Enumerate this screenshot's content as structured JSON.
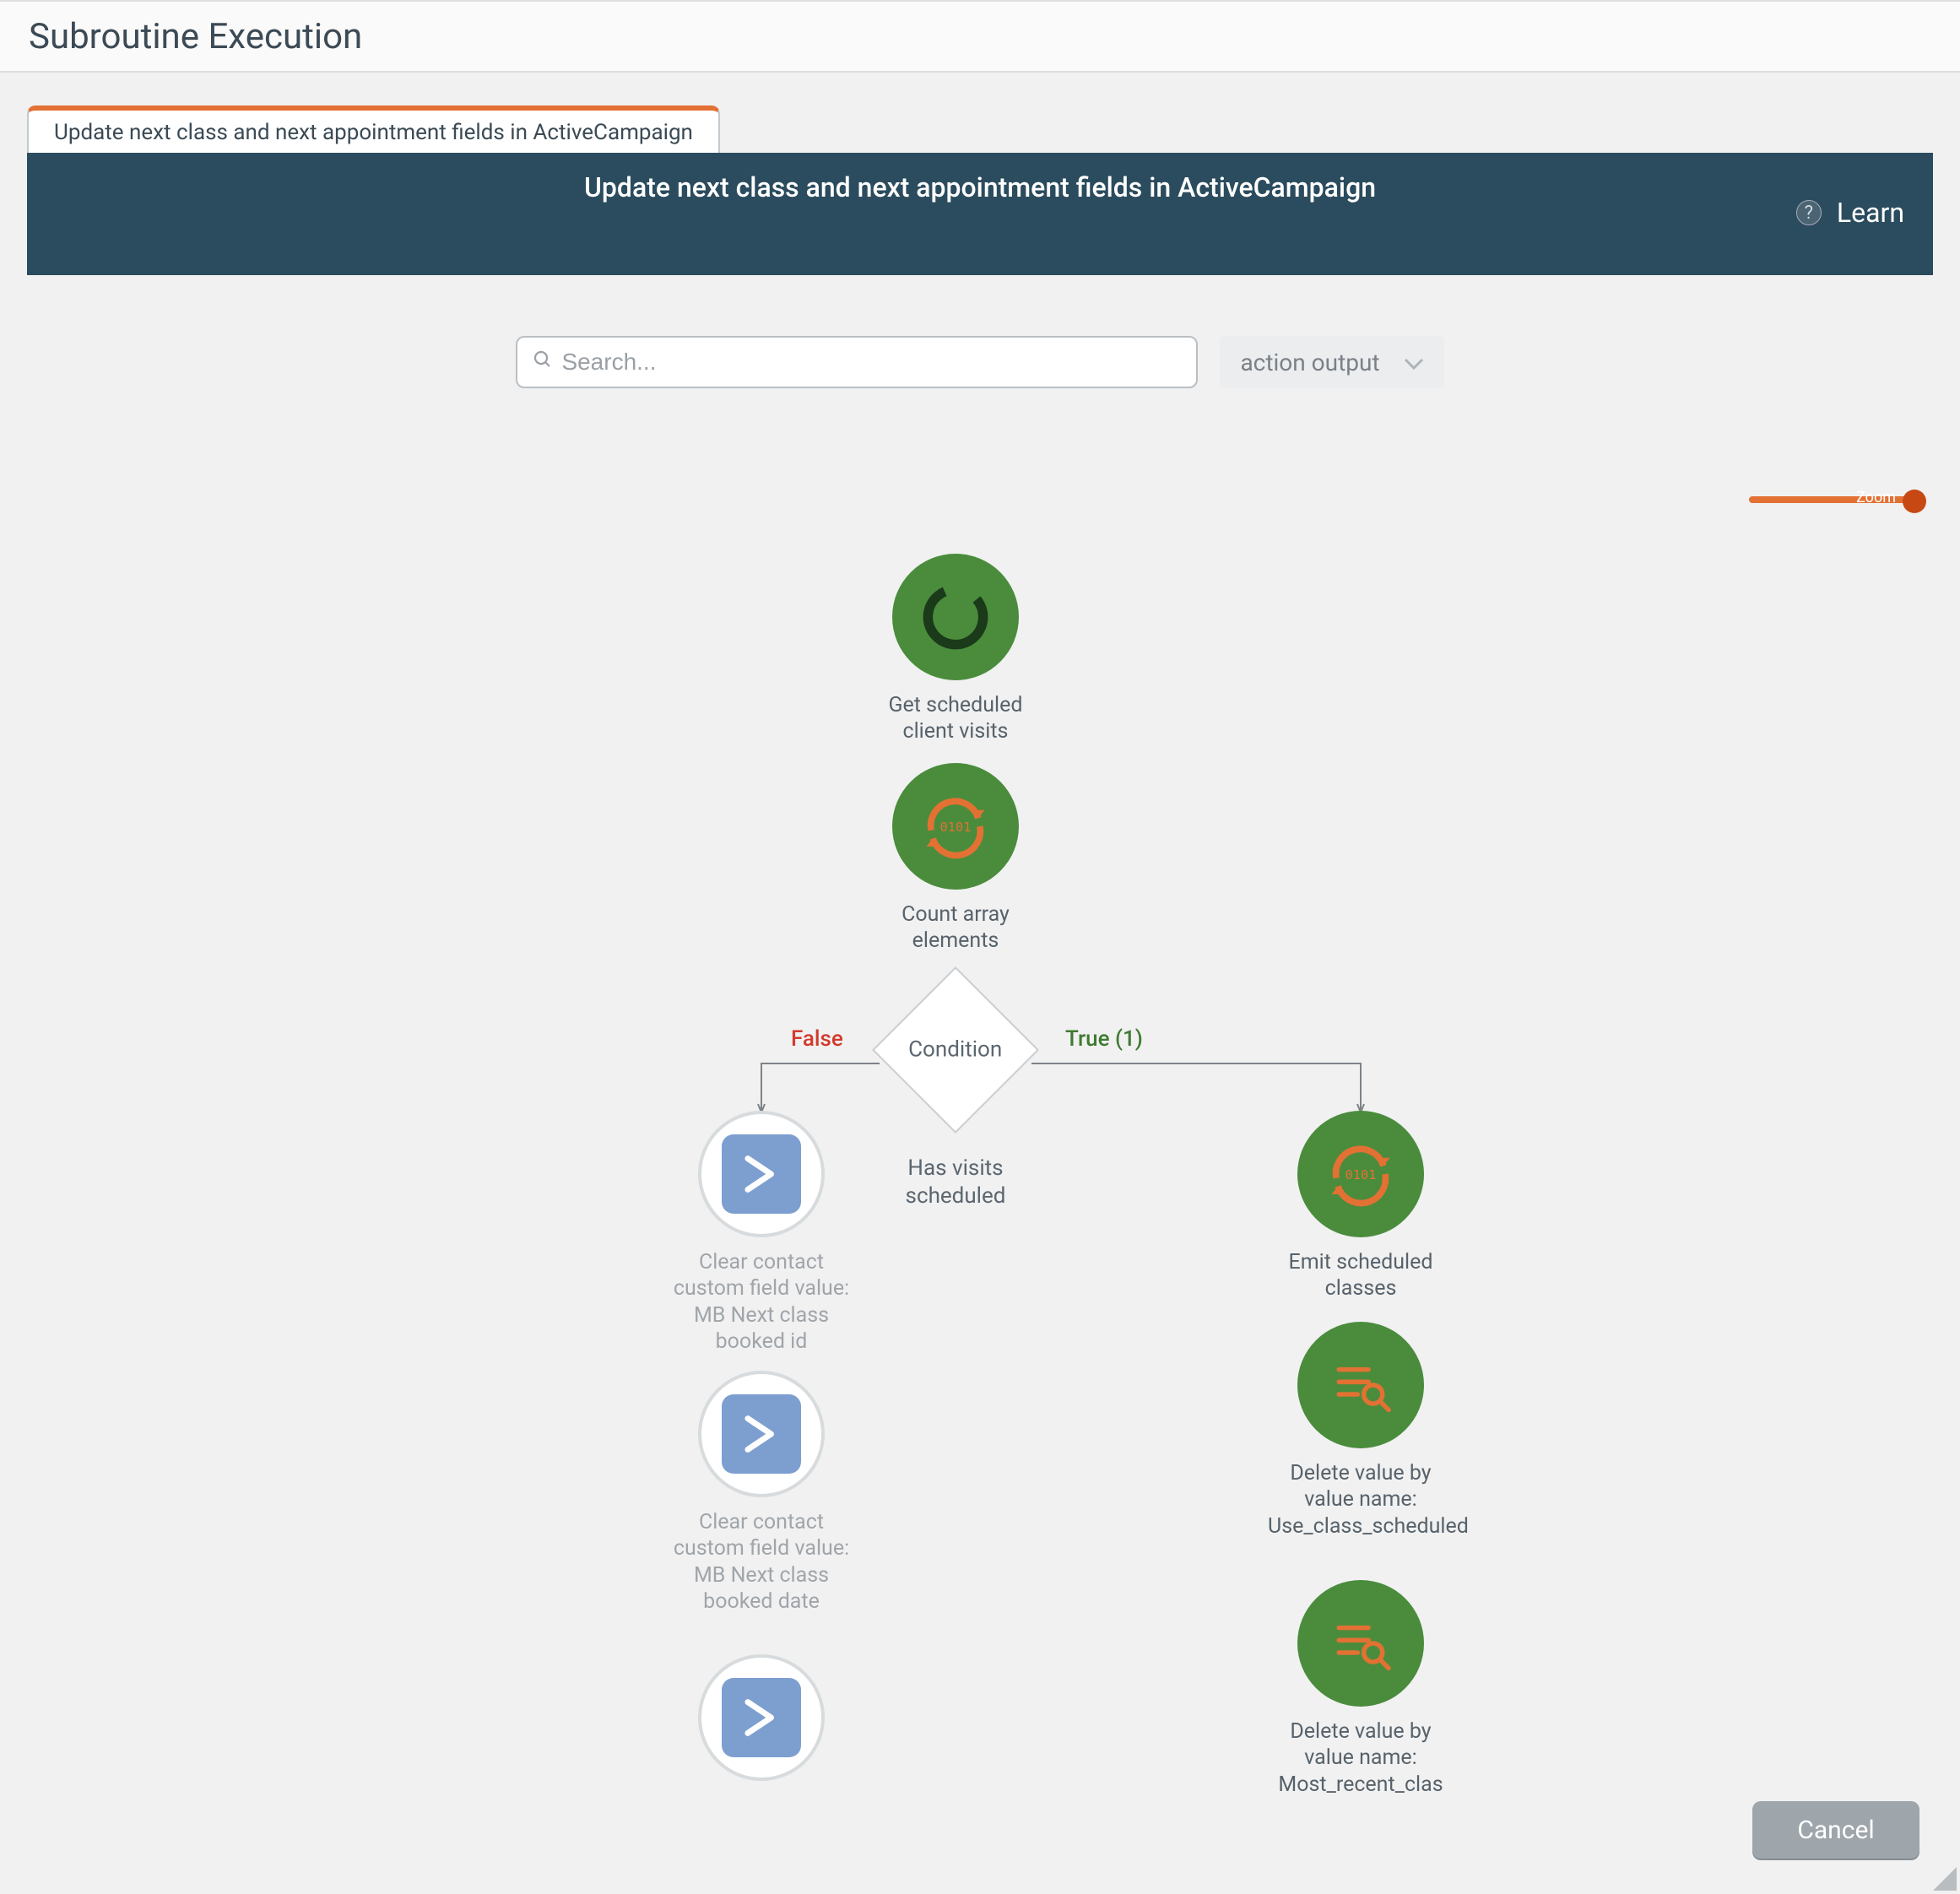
{
  "page_title": "Subroutine Execution",
  "tab": {
    "label": "Update next class and next appointment fields in ActiveCampaign"
  },
  "banner": {
    "title": "Update next class and next appointment fields in ActiveCampaign"
  },
  "learn": {
    "label": "Learn",
    "q": "?"
  },
  "search": {
    "placeholder": "Search..."
  },
  "dropdown": {
    "label": "action output"
  },
  "zoom": {
    "label": "Zoom"
  },
  "condition": {
    "label": "Condition",
    "caption": "Has visits scheduled",
    "false_label": "False",
    "true_label": "True (1)"
  },
  "nodes": {
    "get_visits": "Get scheduled client visits",
    "count_array": "Count array elements",
    "clear_id": "Clear contact custom field value: MB Next class booked id",
    "clear_date": "Clear contact custom field value: MB Next class booked date",
    "emit": "Emit scheduled classes",
    "del1": "Delete value by value name: Use_class_scheduled",
    "del2": "Delete value by value name: Most_recent_clas"
  },
  "buttons": {
    "cancel": "Cancel"
  }
}
